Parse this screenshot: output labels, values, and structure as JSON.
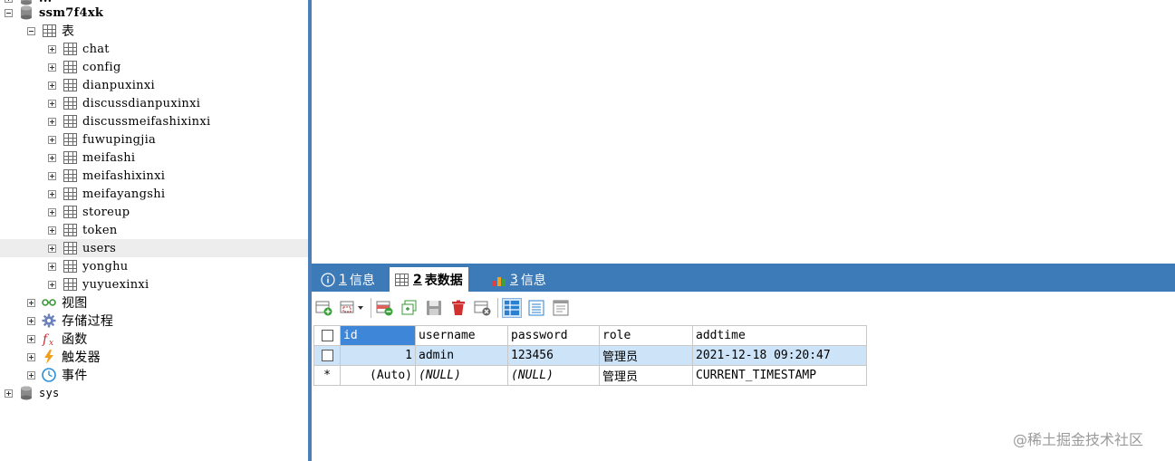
{
  "tree": {
    "db_top_partial": "...",
    "db": "ssm7f4xk",
    "tables_group": "表",
    "tables": [
      "chat",
      "config",
      "dianpuxinxi",
      "discussdianpuxinxi",
      "discussmeifashixinxi",
      "fuwupingjia",
      "meifashi",
      "meifashixinxi",
      "meifayangshi",
      "storeup",
      "token",
      "users",
      "yonghu",
      "yuyuexinxi"
    ],
    "selected_table": "users",
    "views": "视图",
    "procedures": "存储过程",
    "functions": "函数",
    "triggers": "触发器",
    "events": "事件",
    "other_db": "sys"
  },
  "tabs": [
    {
      "num": "1",
      "label": "信息",
      "icon": "info-icon"
    },
    {
      "num": "2",
      "label": "表数据",
      "icon": "table-icon",
      "active": true
    },
    {
      "num": "3",
      "label": "信息",
      "icon": "chart-icon"
    }
  ],
  "grid": {
    "columns": [
      "id",
      "username",
      "password",
      "role",
      "addtime"
    ],
    "rows": [
      {
        "marker": "",
        "id": "1",
        "username": "admin",
        "password": "123456",
        "role": "管理员",
        "addtime": "2021-12-18 09:20:47"
      },
      {
        "marker": "*",
        "id": "(Auto)",
        "username": "(NULL)",
        "password": "(NULL)",
        "role": "管理员",
        "addtime": "CURRENT_TIMESTAMP"
      }
    ]
  },
  "watermark": "@稀土掘金技术社区"
}
